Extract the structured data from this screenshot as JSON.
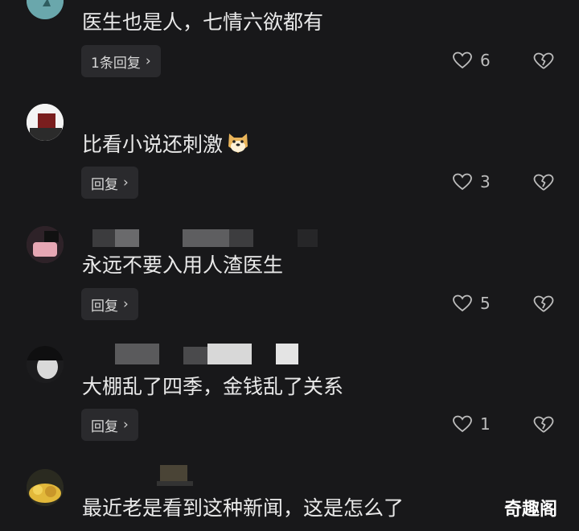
{
  "comments": [
    {
      "text": "医生也是人，七情六欲都有",
      "reply_label": "1条回复",
      "likes": "6"
    },
    {
      "text": "比看小说还刺激",
      "reply_label": "回复",
      "likes": "3"
    },
    {
      "text": "永远不要入用人渣医生",
      "reply_label": "回复",
      "likes": "5"
    },
    {
      "text": "大棚乱了四季，金钱乱了关系",
      "reply_label": "回复",
      "likes": "1"
    },
    {
      "text": "最近老是看到这种新闻，这是怎么了"
    }
  ],
  "icons": {
    "like": "heart-outline-icon",
    "dislike": "broken-heart-icon",
    "reply_chevron": "chevron-right-icon",
    "emoji": "doge-emoji-icon"
  },
  "watermark": "奇趣阁",
  "colors": {
    "background": "#18181a",
    "button_bg": "#2a2a2d",
    "text": "#e9e9e9"
  }
}
